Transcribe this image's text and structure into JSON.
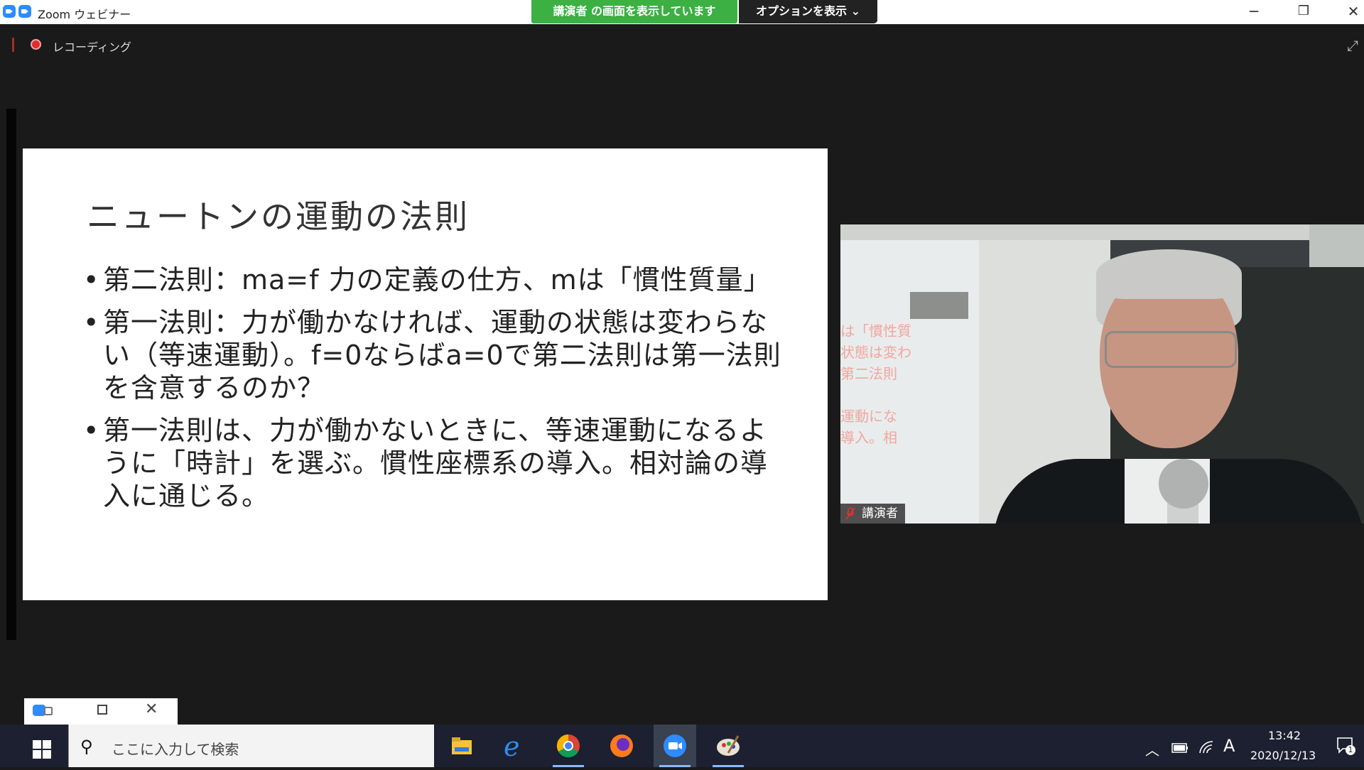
{
  "window": {
    "title": "Zoom ウェビナー",
    "share_banner": "講演者 の画面を表示しています",
    "options_label": "オプションを表示 ⌄",
    "minimize_glyph": "─",
    "restore_glyph": "❐",
    "close_glyph": "✕"
  },
  "recording": {
    "label": "レコーディング"
  },
  "slide": {
    "title": "ニュートンの運動の法則",
    "bullet_glyph": "•",
    "bullets": [
      {
        "text": "第二法則：ma=f 力の定義の仕方、mは「慣性質量」"
      },
      {
        "text": "第一法則：力が働かなければ、運動の状態は変わらない（等速運動）。f=0ならばa=0で第二法則は第一法則を含意するのか？"
      },
      {
        "text": "第一法則は、力が働かないときに、等速運動になるように「時計」を選ぶ。慣性座標系の導入。相対論の導入に通じる。"
      }
    ]
  },
  "video": {
    "participant_name": "講演者",
    "muted": true,
    "reflection_text": "は「慣性質\n状態は変わ\n第二法則\n\n運動にな\n導入。相"
  },
  "mini_window": {
    "close_glyph": "✕"
  },
  "taskbar": {
    "search_placeholder": "ここに入力して検索",
    "search_glyph": "⚲",
    "tray_up": "︿",
    "tray_ime": "A",
    "time": "13:42",
    "date": "2020/12/13",
    "notification_count": "1"
  },
  "colors": {
    "share_banner": "#3cb043",
    "zoom_blue": "#2d8cff",
    "taskbar": "#1c2030"
  }
}
